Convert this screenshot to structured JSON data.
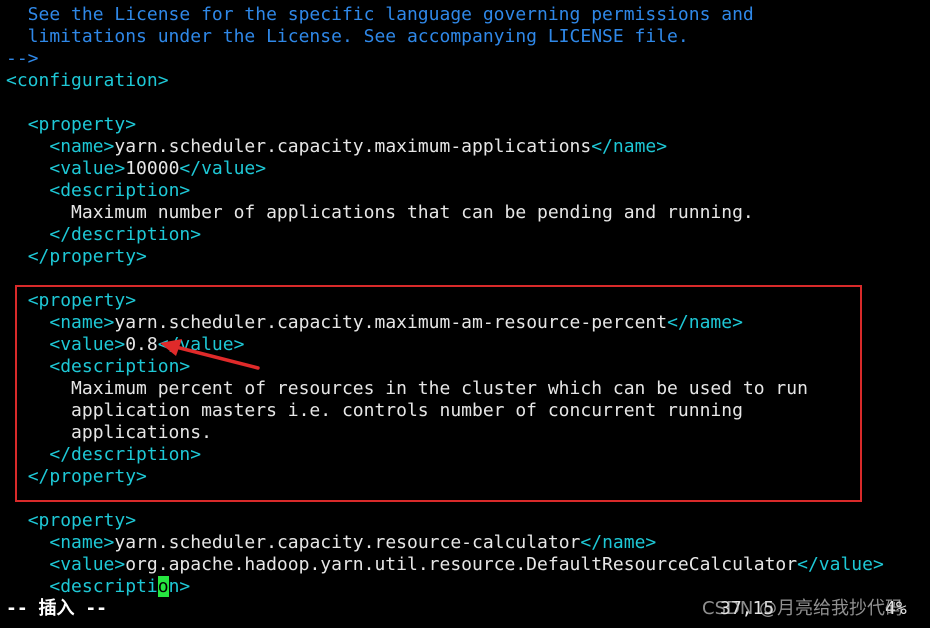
{
  "editor": {
    "lines": [
      {
        "segments": [
          {
            "text": "  See the License for the specific language governing permissions and",
            "class": "c"
          }
        ]
      },
      {
        "segments": [
          {
            "text": "  limitations under the License. See accompanying LICENSE file.",
            "class": "c"
          }
        ]
      },
      {
        "segments": [
          {
            "text": "-->",
            "class": "c"
          }
        ]
      },
      {
        "segments": [
          {
            "text": "<configuration>",
            "class": "t"
          }
        ]
      },
      {
        "segments": [
          {
            "text": "",
            "class": "txt"
          }
        ]
      },
      {
        "segments": [
          {
            "text": "  ",
            "class": "txt"
          },
          {
            "text": "<property>",
            "class": "t"
          }
        ]
      },
      {
        "segments": [
          {
            "text": "    ",
            "class": "txt"
          },
          {
            "text": "<name>",
            "class": "t"
          },
          {
            "text": "yarn.scheduler.capacity.maximum-applications",
            "class": "txt"
          },
          {
            "text": "</name>",
            "class": "t"
          }
        ]
      },
      {
        "segments": [
          {
            "text": "    ",
            "class": "txt"
          },
          {
            "text": "<value>",
            "class": "t"
          },
          {
            "text": "10000",
            "class": "txt"
          },
          {
            "text": "</value>",
            "class": "t"
          }
        ]
      },
      {
        "segments": [
          {
            "text": "    ",
            "class": "txt"
          },
          {
            "text": "<description>",
            "class": "t"
          }
        ]
      },
      {
        "segments": [
          {
            "text": "      Maximum number of applications that can be pending and running.",
            "class": "txt"
          }
        ]
      },
      {
        "segments": [
          {
            "text": "    ",
            "class": "txt"
          },
          {
            "text": "</description>",
            "class": "t"
          }
        ]
      },
      {
        "segments": [
          {
            "text": "  ",
            "class": "txt"
          },
          {
            "text": "</property>",
            "class": "t"
          }
        ]
      },
      {
        "segments": [
          {
            "text": "",
            "class": "txt"
          }
        ]
      },
      {
        "segments": [
          {
            "text": "  ",
            "class": "txt"
          },
          {
            "text": "<property>",
            "class": "t"
          }
        ]
      },
      {
        "segments": [
          {
            "text": "    ",
            "class": "txt"
          },
          {
            "text": "<name>",
            "class": "t"
          },
          {
            "text": "yarn.scheduler.capacity.maximum-am-resource-percent",
            "class": "txt"
          },
          {
            "text": "</name>",
            "class": "t"
          }
        ]
      },
      {
        "segments": [
          {
            "text": "    ",
            "class": "txt"
          },
          {
            "text": "<value>",
            "class": "t"
          },
          {
            "text": "0.8",
            "class": "txt"
          },
          {
            "text": "</value>",
            "class": "t"
          }
        ]
      },
      {
        "segments": [
          {
            "text": "    ",
            "class": "txt"
          },
          {
            "text": "<description>",
            "class": "t"
          }
        ]
      },
      {
        "segments": [
          {
            "text": "      Maximum percent of resources in the cluster which can be used to run",
            "class": "txt"
          }
        ]
      },
      {
        "segments": [
          {
            "text": "      application masters i.e. controls number of concurrent running",
            "class": "txt"
          }
        ]
      },
      {
        "segments": [
          {
            "text": "      applications.",
            "class": "txt"
          }
        ]
      },
      {
        "segments": [
          {
            "text": "    ",
            "class": "txt"
          },
          {
            "text": "</description>",
            "class": "t"
          }
        ]
      },
      {
        "segments": [
          {
            "text": "  ",
            "class": "txt"
          },
          {
            "text": "</property>",
            "class": "t"
          }
        ]
      },
      {
        "segments": [
          {
            "text": "",
            "class": "txt"
          }
        ]
      },
      {
        "segments": [
          {
            "text": "  ",
            "class": "txt"
          },
          {
            "text": "<property>",
            "class": "t"
          }
        ]
      },
      {
        "segments": [
          {
            "text": "    ",
            "class": "txt"
          },
          {
            "text": "<name>",
            "class": "t"
          },
          {
            "text": "yarn.scheduler.capacity.resource-calculator",
            "class": "txt"
          },
          {
            "text": "</name>",
            "class": "t"
          }
        ]
      },
      {
        "segments": [
          {
            "text": "    ",
            "class": "txt"
          },
          {
            "text": "<value>",
            "class": "t"
          },
          {
            "text": "org.apache.hadoop.yarn.util.resource.DefaultResourceCalculator",
            "class": "txt"
          },
          {
            "text": "</value>",
            "class": "t"
          }
        ]
      },
      {
        "segments": [
          {
            "text": "    ",
            "class": "txt"
          },
          {
            "text": "<descripti",
            "class": "t"
          },
          {
            "text": "o",
            "class": "cursor-cell"
          },
          {
            "text": "n>",
            "class": "t"
          }
        ]
      }
    ]
  },
  "status_bar": {
    "mode": "-- 插入 --",
    "position": "37,15",
    "percent": "4%"
  },
  "watermark": "CSDN @月亮给我抄代码",
  "colors": {
    "background": "#000000",
    "tag": "#1ec8d6",
    "comment": "#2f88e8",
    "text": "#e6e6e6",
    "cursor": "#26e640",
    "highlight_border": "#d92a2a"
  }
}
